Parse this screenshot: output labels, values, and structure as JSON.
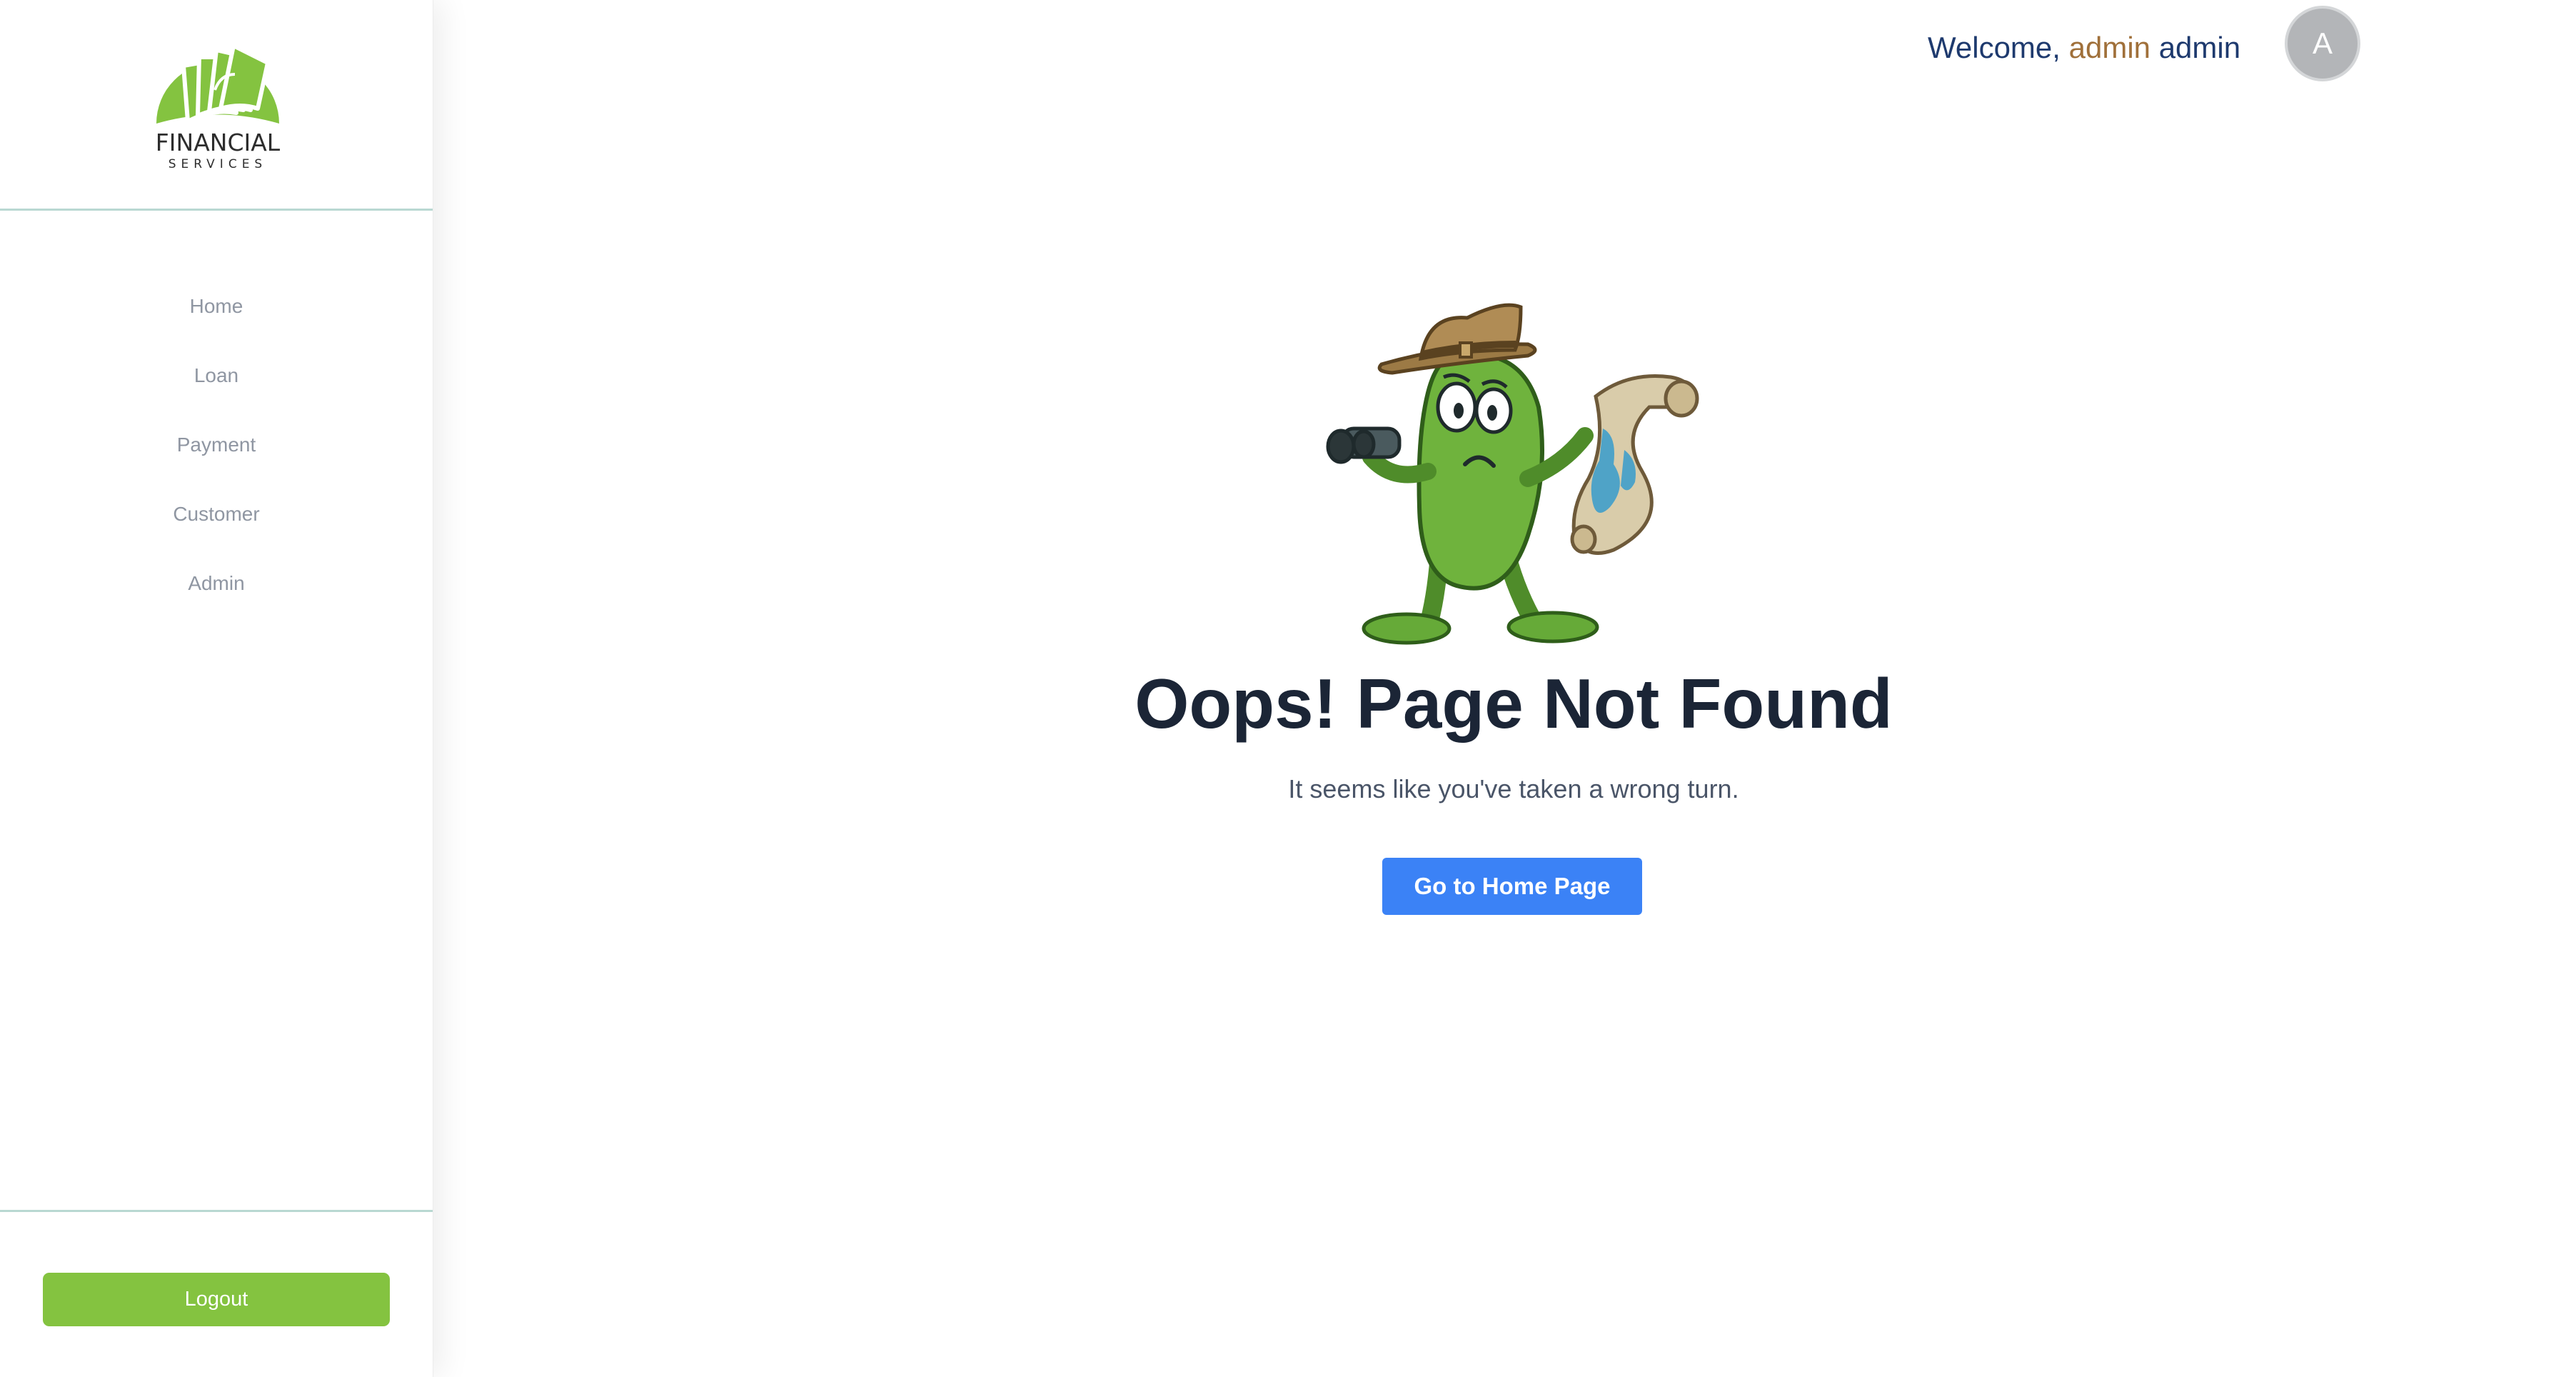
{
  "brand": {
    "name": "FINANCIAL",
    "tagline": "SERVICES",
    "accent_color": "#84c340",
    "logo_icon": "documents-leaf-icon"
  },
  "sidebar": {
    "items": [
      {
        "label": "Home"
      },
      {
        "label": "Loan"
      },
      {
        "label": "Payment"
      },
      {
        "label": "Customer"
      },
      {
        "label": "Admin"
      }
    ],
    "logout_label": "Logout"
  },
  "header": {
    "welcome": "Welcome,",
    "user_first": "admin",
    "user_last": "admin",
    "avatar_initial": "A"
  },
  "main": {
    "illustration_icon": "explorer-bean-with-binoculars-and-map-icon",
    "title": "Oops! Page Not Found",
    "subtitle": "It seems like you've taken a wrong turn.",
    "button_label": "Go to Home Page",
    "button_color": "#3b82f6"
  }
}
